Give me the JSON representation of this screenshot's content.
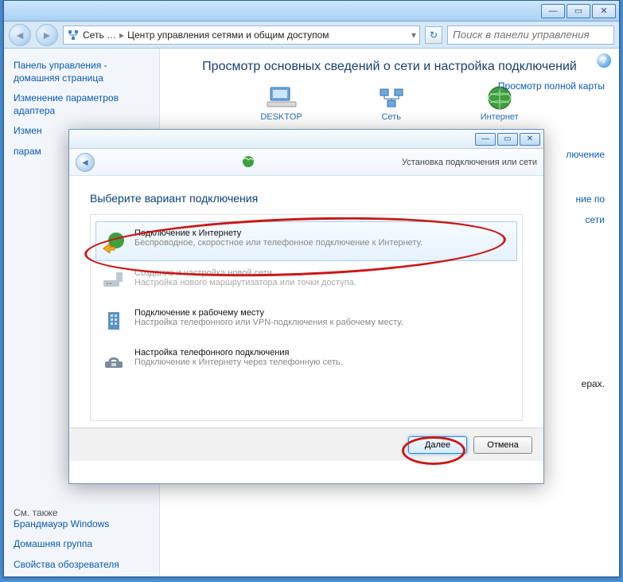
{
  "explorer": {
    "breadcrumb": {
      "root": "Сеть …",
      "current": "Центр управления сетями и общим доступом"
    },
    "search_placeholder": "Поиск в панели управления",
    "heading": "Просмотр основных сведений о сети и настройка подключений",
    "netnodes": {
      "desktop": "DESKTOP",
      "network": "Сеть",
      "internet": "Интернет"
    },
    "rightlinks": {
      "map": "Просмотр полной карты",
      "conn": "лючение",
      "on": "ние по",
      "net": "сети",
      "params": "ерах."
    },
    "sidebar": {
      "cp_home": "Панель управления - домашняя страница",
      "adapter": "Изменение параметров адаптера",
      "sharing1": "Измен",
      "sharing2": "парам",
      "see_also": "См. также",
      "firewall": "Брандмауэр Windows",
      "homegroup": "Домашняя группа",
      "browser": "Свойства обозревателя"
    }
  },
  "wizard": {
    "title": "Установка подключения или сети",
    "heading": "Выберите вариант подключения",
    "options": [
      {
        "title": "Подключение к Интернету",
        "desc": "Беспроводное, скоростное или телефонное подключение к Интернету."
      },
      {
        "title": "Создание и настройка новой сети",
        "desc": "Настройка нового маршрутизатора или точки доступа."
      },
      {
        "title": "Подключение к рабочему месту",
        "desc": "Настройка телефонного или VPN-подключения к рабочему месту."
      },
      {
        "title": "Настройка телефонного подключения",
        "desc": "Подключение к Интернету через телефонную сеть."
      }
    ],
    "next": "Далее",
    "cancel": "Отмена"
  }
}
